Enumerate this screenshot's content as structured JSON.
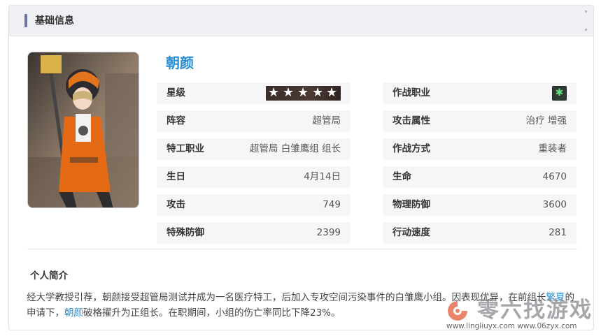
{
  "header": {
    "title": "基础信息"
  },
  "character": {
    "name": "朝颜",
    "portrait_icon": "character-portrait-icon"
  },
  "left_rows": [
    {
      "label": "星级",
      "value": "",
      "stars": 5
    },
    {
      "label": "阵容",
      "value": "超管局"
    },
    {
      "label": "特工职业",
      "value": "超管局 白雏鹰组 组长"
    },
    {
      "label": "生日",
      "value": "4月14日"
    },
    {
      "label": "攻击",
      "value": "749"
    },
    {
      "label": "特殊防御",
      "value": "2399"
    }
  ],
  "right_rows": [
    {
      "label": "作战职业",
      "value": "",
      "icon": "healer-class-icon"
    },
    {
      "label": "攻击属性",
      "value": "治疗 增强"
    },
    {
      "label": "作战方式",
      "value": "重装者"
    },
    {
      "label": "生命",
      "value": "4670"
    },
    {
      "label": "物理防御",
      "value": "3600"
    },
    {
      "label": "行动速度",
      "value": "281"
    }
  ],
  "intro": {
    "title": "个人简介",
    "text_1": "经大学教授引荐，朝颜接受超管局测试并成为一名医疗特工，后加入专攻空间污染事件的白雏鹰小组。因表现优异，在前组长",
    "link_1": "繁夏",
    "text_2": "的申请下，",
    "link_2": "朝颜",
    "text_3": "破格擢升为正组长。在职期间，小组的伤亡率同比下降23%。"
  },
  "watermark": {
    "logo_text": "零六找游戏",
    "url": "www.lingliuyx.com   www.06zyx.com"
  },
  "colors": {
    "accent": "#2a8ed3",
    "header_bg": "#eef0f4",
    "row_bg": "#f6f6f8",
    "header_bar": "#6a74a0"
  }
}
